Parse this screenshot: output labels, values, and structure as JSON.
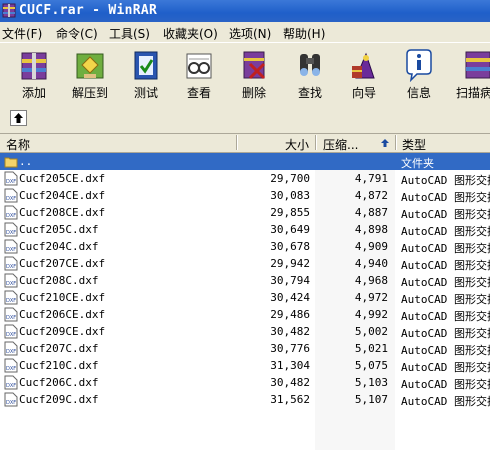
{
  "window": {
    "title": "CUCF.rar - WinRAR"
  },
  "menu": [
    {
      "label": "文件(F)"
    },
    {
      "label": "命令(C)"
    },
    {
      "label": "工具(S)"
    },
    {
      "label": "收藏夹(O)"
    },
    {
      "label": "选项(N)"
    },
    {
      "label": "帮助(H)"
    }
  ],
  "toolbar": [
    {
      "label": "添加",
      "icon": "add-icon"
    },
    {
      "label": "解压到",
      "icon": "extract-icon"
    },
    {
      "label": "测试",
      "icon": "test-icon"
    },
    {
      "label": "查看",
      "icon": "view-icon"
    },
    {
      "label": "删除",
      "icon": "delete-icon"
    },
    {
      "label": "查找",
      "icon": "find-icon"
    },
    {
      "label": "向导",
      "icon": "wizard-icon"
    },
    {
      "label": "信息",
      "icon": "info-icon"
    },
    {
      "label": "扫描病",
      "icon": "scan-icon"
    }
  ],
  "columns": {
    "name": "名称",
    "size": "大小",
    "packed": "压缩...",
    "type": "类型"
  },
  "parent_row": {
    "name": "..",
    "type": "文件夹"
  },
  "files": [
    {
      "name": "Cucf205CE.dxf",
      "size": "29,700",
      "packed": "4,791",
      "type": "AutoCAD 图形交换"
    },
    {
      "name": "Cucf204CE.dxf",
      "size": "30,083",
      "packed": "4,872",
      "type": "AutoCAD 图形交换"
    },
    {
      "name": "Cucf208CE.dxf",
      "size": "29,855",
      "packed": "4,887",
      "type": "AutoCAD 图形交换"
    },
    {
      "name": "Cucf205C.dxf",
      "size": "30,649",
      "packed": "4,898",
      "type": "AutoCAD 图形交换"
    },
    {
      "name": "Cucf204C.dxf",
      "size": "30,678",
      "packed": "4,909",
      "type": "AutoCAD 图形交换"
    },
    {
      "name": "Cucf207CE.dxf",
      "size": "29,942",
      "packed": "4,940",
      "type": "AutoCAD 图形交换"
    },
    {
      "name": "Cucf208C.dxf",
      "size": "30,794",
      "packed": "4,968",
      "type": "AutoCAD 图形交换"
    },
    {
      "name": "Cucf210CE.dxf",
      "size": "30,424",
      "packed": "4,972",
      "type": "AutoCAD 图形交换"
    },
    {
      "name": "Cucf206CE.dxf",
      "size": "29,486",
      "packed": "4,992",
      "type": "AutoCAD 图形交换"
    },
    {
      "name": "Cucf209CE.dxf",
      "size": "30,482",
      "packed": "5,002",
      "type": "AutoCAD 图形交换"
    },
    {
      "name": "Cucf207C.dxf",
      "size": "30,776",
      "packed": "5,021",
      "type": "AutoCAD 图形交换"
    },
    {
      "name": "Cucf210C.dxf",
      "size": "31,304",
      "packed": "5,075",
      "type": "AutoCAD 图形交换"
    },
    {
      "name": "Cucf206C.dxf",
      "size": "30,482",
      "packed": "5,103",
      "type": "AutoCAD 图形交换"
    },
    {
      "name": "Cucf209C.dxf",
      "size": "31,562",
      "packed": "5,107",
      "type": "AutoCAD 图形交换"
    }
  ],
  "colors": {
    "titlebar": "#1f5fc9",
    "selection": "#316ac5",
    "chrome": "#ece9d8"
  }
}
